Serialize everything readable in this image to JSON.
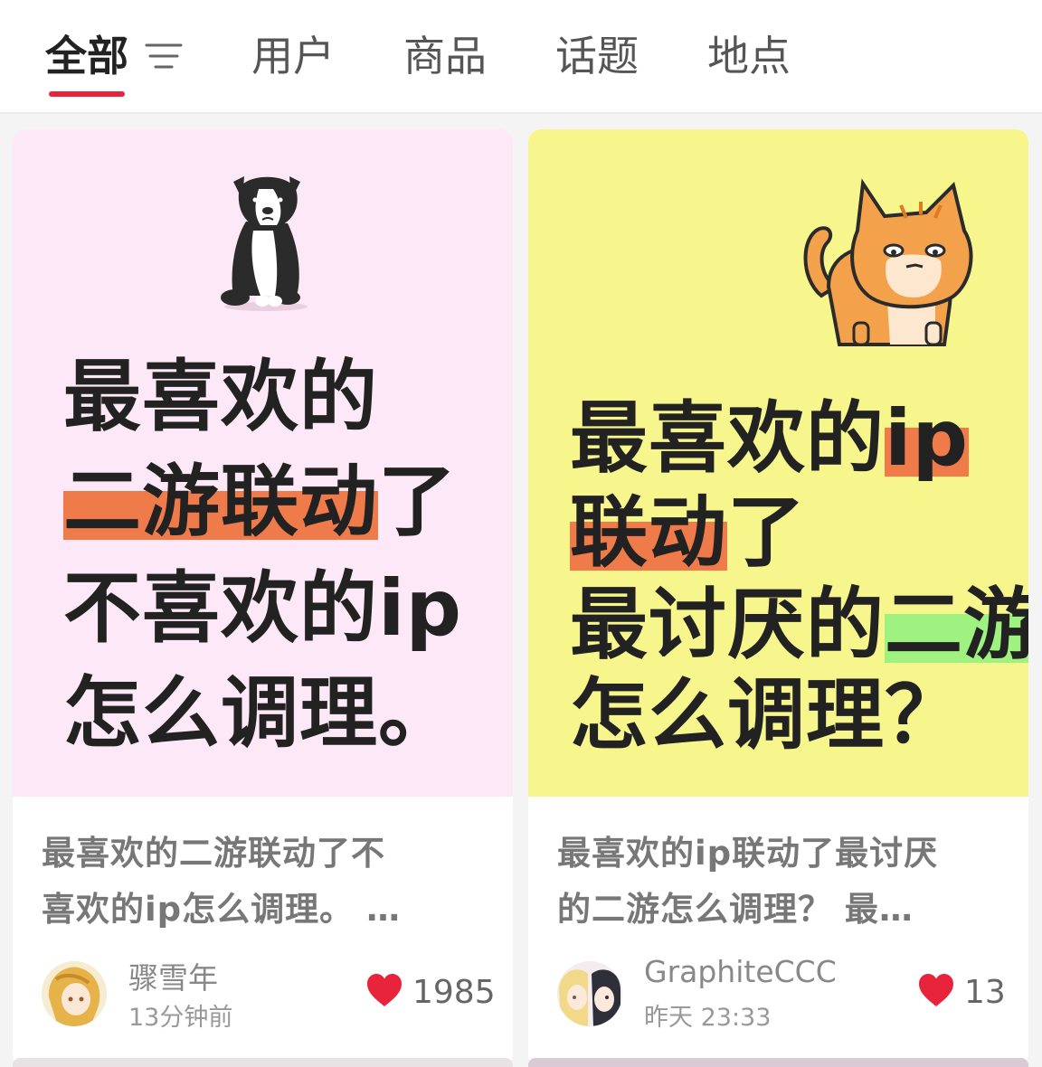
{
  "colors": {
    "accent": "#e8243c",
    "card1_bg": "#fce8f6",
    "card2_bg": "#f7f68d",
    "highlight_orange": "#ef7b4a",
    "highlight_green": "#9ff27f"
  },
  "tabs": [
    {
      "label": "全部",
      "active": true
    },
    {
      "label": "用户",
      "active": false
    },
    {
      "label": "商品",
      "active": false
    },
    {
      "label": "话题",
      "active": false
    },
    {
      "label": "地点",
      "active": false
    }
  ],
  "filter_icon": "filter-lines-icon",
  "cards": [
    {
      "cover": {
        "line1": "最喜欢的",
        "line2_hl": "二游联动",
        "line2_rest": "了",
        "line3": "不喜欢的ip",
        "line4": "怎么调理。",
        "illustration": "dog-illustration"
      },
      "title_line1": "最喜欢的二游联动了不",
      "title_line2": "喜欢的ip怎么调理。 …",
      "author": "骤雪年",
      "time": "13分钟前",
      "likes": "1985",
      "like_icon": "heart-icon"
    },
    {
      "cover": {
        "line1_a": "最喜欢的",
        "line1_hl": "ip",
        "line2_hl": "联动",
        "line2_rest": "了",
        "line3_a": "最讨厌的",
        "line3_hl": "二游",
        "line4": "怎么调理？",
        "illustration": "cat-illustration"
      },
      "title_line1": "最喜欢的ip联动了最讨厌",
      "title_line2": "的二游怎么调理？ 最…",
      "author": "GraphiteCCC",
      "time": "昨天 23:33",
      "likes": "13",
      "like_icon": "heart-icon"
    }
  ]
}
